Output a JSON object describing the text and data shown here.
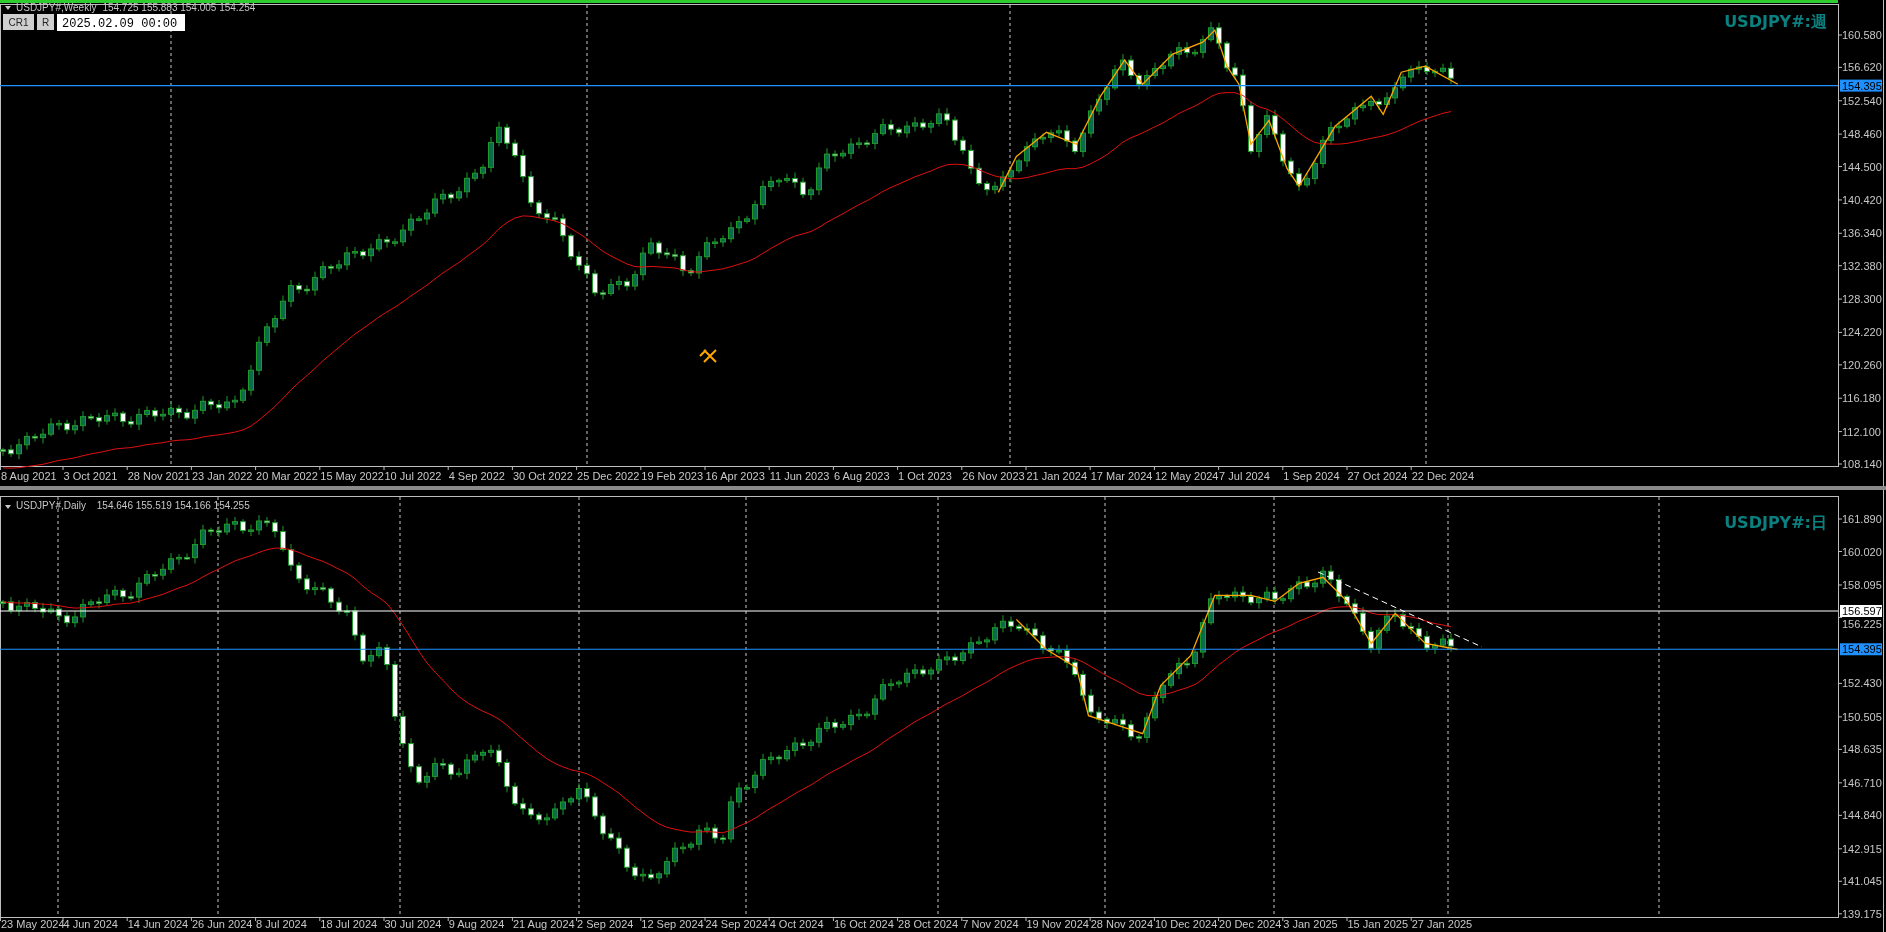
{
  "charts": [
    {
      "title": "USDJPY#,Weekly",
      "ohlc": "154.725 155.883 154.005 154.254",
      "active": true,
      "toolbar": {
        "buttons": [
          "CR1",
          "R"
        ],
        "date_field": "2025.02.09 00:00"
      },
      "symbol_label": "USDJPY#:週",
      "price_axis": [
        "160.580",
        "156.620",
        "152.540",
        "148.460",
        "144.500",
        "140.420",
        "136.340",
        "132.380",
        "128.300",
        "124.220",
        "120.260",
        "116.180",
        "112.100",
        "108.140"
      ],
      "price_lines": [
        {
          "kind": "bid",
          "label": "154.395"
        }
      ],
      "time_axis": [
        "8 Aug 2021",
        "3 Oct 2021",
        "28 Nov 2021",
        "23 Jan 2022",
        "20 Mar 2022",
        "15 May 2022",
        "10 Jul 2022",
        "4 Sep 2022",
        "30 Oct 2022",
        "25 Dec 2022",
        "19 Feb 2023",
        "16 Apr 2023",
        "11 Jun 2023",
        "6 Aug 2023",
        "1 Oct 2023",
        "26 Nov 2023",
        "21 Jan 2024",
        "17 Mar 2024",
        "12 May 2024",
        "7 Jul 2024",
        "1 Sep 2024",
        "27 Oct 2024",
        "22 Dec 2024"
      ]
    },
    {
      "title": "USDJPY#,Daily",
      "ohlc": "154.646 155.519 154.166 154.255",
      "active": false,
      "symbol_label": "USDJPY#:日",
      "price_axis": [
        "161.890",
        "160.020",
        "158.095",
        "156.225",
        "152.430",
        "150.505",
        "148.635",
        "146.710",
        "144.840",
        "142.915",
        "141.045",
        "139.175"
      ],
      "price_lines": [
        {
          "kind": "level",
          "label": "156.597"
        },
        {
          "kind": "bid",
          "label": "154.395"
        }
      ],
      "time_axis": [
        "23 May 2024",
        "4 Jun 2024",
        "14 Jun 2024",
        "26 Jun 2024",
        "8 Jul 2024",
        "18 Jul 2024",
        "30 Jul 2024",
        "9 Aug 2024",
        "21 Aug 2024",
        "2 Sep 2024",
        "12 Sep 2024",
        "24 Sep 2024",
        "4 Oct 2024",
        "16 Oct 2024",
        "28 Oct 2024",
        "7 Nov 2024",
        "19 Nov 2024",
        "28 Nov 2024",
        "10 Dec 2024",
        "20 Dec 2024",
        "3 Jan 2025",
        "15 Jan 2025",
        "27 Jan 2025"
      ]
    }
  ]
}
